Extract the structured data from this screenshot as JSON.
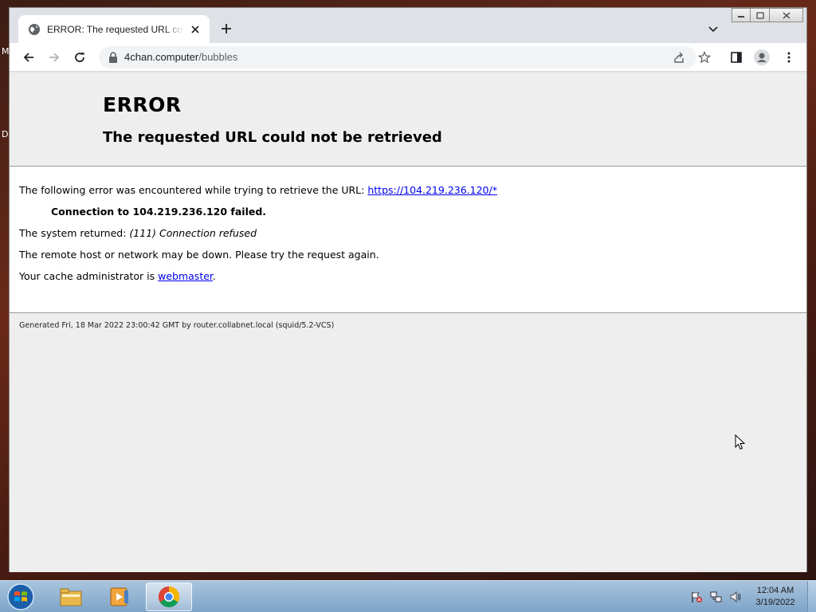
{
  "desktop": {
    "label_1": "M",
    "label_2": "D"
  },
  "browser": {
    "tab_title": "ERROR: The requested URL could not be retrieved",
    "url_host": "4chan.computer",
    "url_path": "/bubbles"
  },
  "page": {
    "title": "ERROR",
    "subtitle": "The requested URL could not be retrieved",
    "line1_text": "The following error was encountered while trying to retrieve the URL: ",
    "line1_link": "https://104.219.236.120/*",
    "line2": "Connection to 104.219.236.120 failed.",
    "line3_text": "The system returned: ",
    "line3_em": "(111) Connection refused",
    "line4": "The remote host or network may be down. Please try the request again.",
    "line5_text": "Your cache administrator is ",
    "line5_link": "webmaster",
    "line5_end": ".",
    "footer": "Generated Fri, 18 Mar 2022 23:00:42 GMT by router.collabnet.local (squid/5.2-VCS)"
  },
  "taskbar": {
    "time": "12:04 AM",
    "date": "3/19/2022"
  },
  "colors": {
    "link": "#0000ee",
    "page_bg": "#eeeeee",
    "chrome_frame": "#dee1e6"
  }
}
